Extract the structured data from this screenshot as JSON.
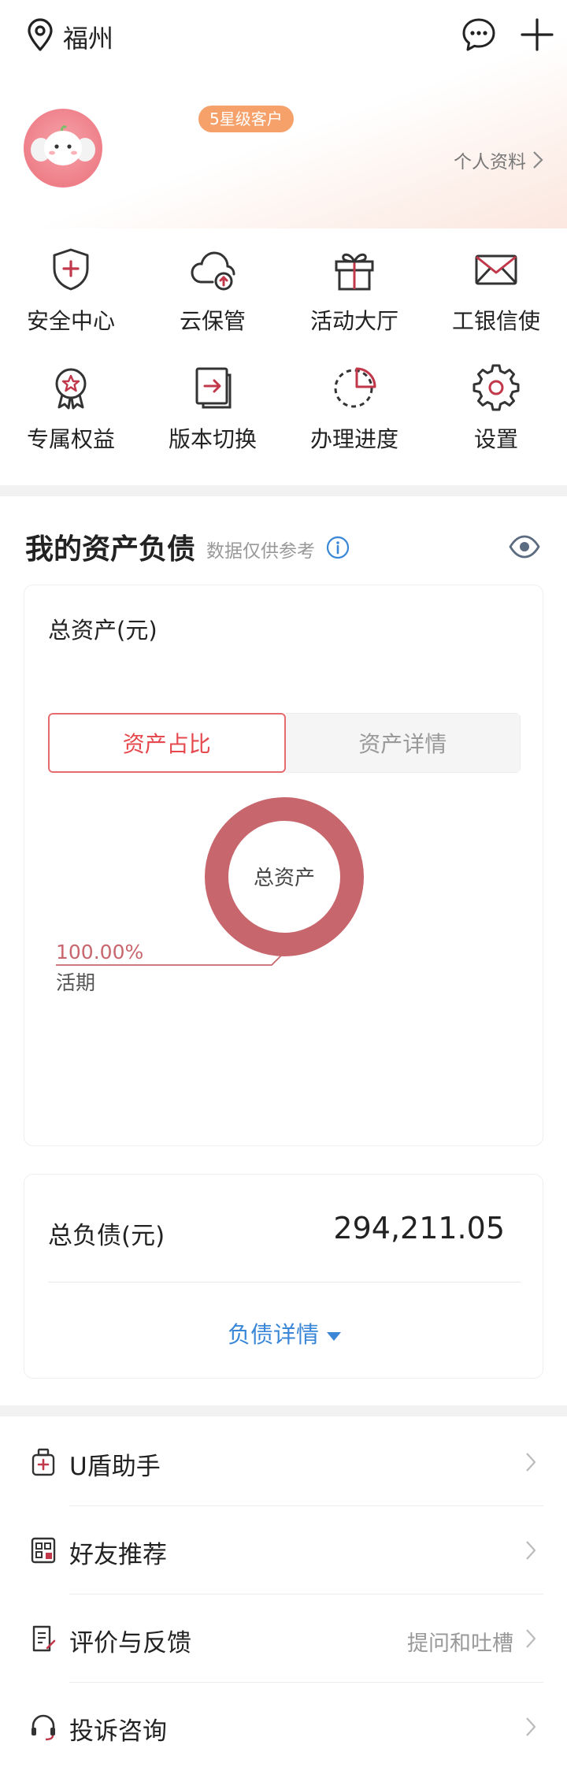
{
  "header": {
    "location": "福州",
    "badge": "5星级客户",
    "profile_link": "个人资料"
  },
  "quick_actions": [
    {
      "label": "安全中心",
      "icon": "shield-plus-icon"
    },
    {
      "label": "云保管",
      "icon": "cloud-upload-icon"
    },
    {
      "label": "活动大厅",
      "icon": "gift-icon"
    },
    {
      "label": "工银信使",
      "icon": "envelope-icon"
    },
    {
      "label": "专属权益",
      "icon": "award-ribbon-icon"
    },
    {
      "label": "版本切换",
      "icon": "switch-version-icon"
    },
    {
      "label": "办理进度",
      "icon": "pie-progress-icon"
    },
    {
      "label": "设置",
      "icon": "gear-icon"
    }
  ],
  "assets": {
    "title": "我的资产负债",
    "subtitle": "数据仅供参考",
    "total_label": "总资产(元)",
    "tabs": [
      "资产占比",
      "资产详情"
    ],
    "active_tab": 0,
    "donut_center": "总资产",
    "segment_percent": "100.00%",
    "segment_name": "活期",
    "accent": "#c8666d"
  },
  "chart_data": {
    "type": "pie",
    "title": "总资产",
    "categories": [
      "活期"
    ],
    "values": [
      100.0
    ]
  },
  "liabilities": {
    "label": "总负债(元)",
    "value": "294,211.05",
    "detail_label": "负债详情"
  },
  "list": [
    {
      "label": "U盾助手",
      "extra": "",
      "icon": "usb-shield-icon"
    },
    {
      "label": "好友推荐",
      "extra": "",
      "icon": "qr-share-icon"
    },
    {
      "label": "评价与反馈",
      "extra": "提问和吐槽",
      "icon": "feedback-doc-icon"
    },
    {
      "label": "投诉咨询",
      "extra": "",
      "icon": "headset-icon"
    }
  ]
}
